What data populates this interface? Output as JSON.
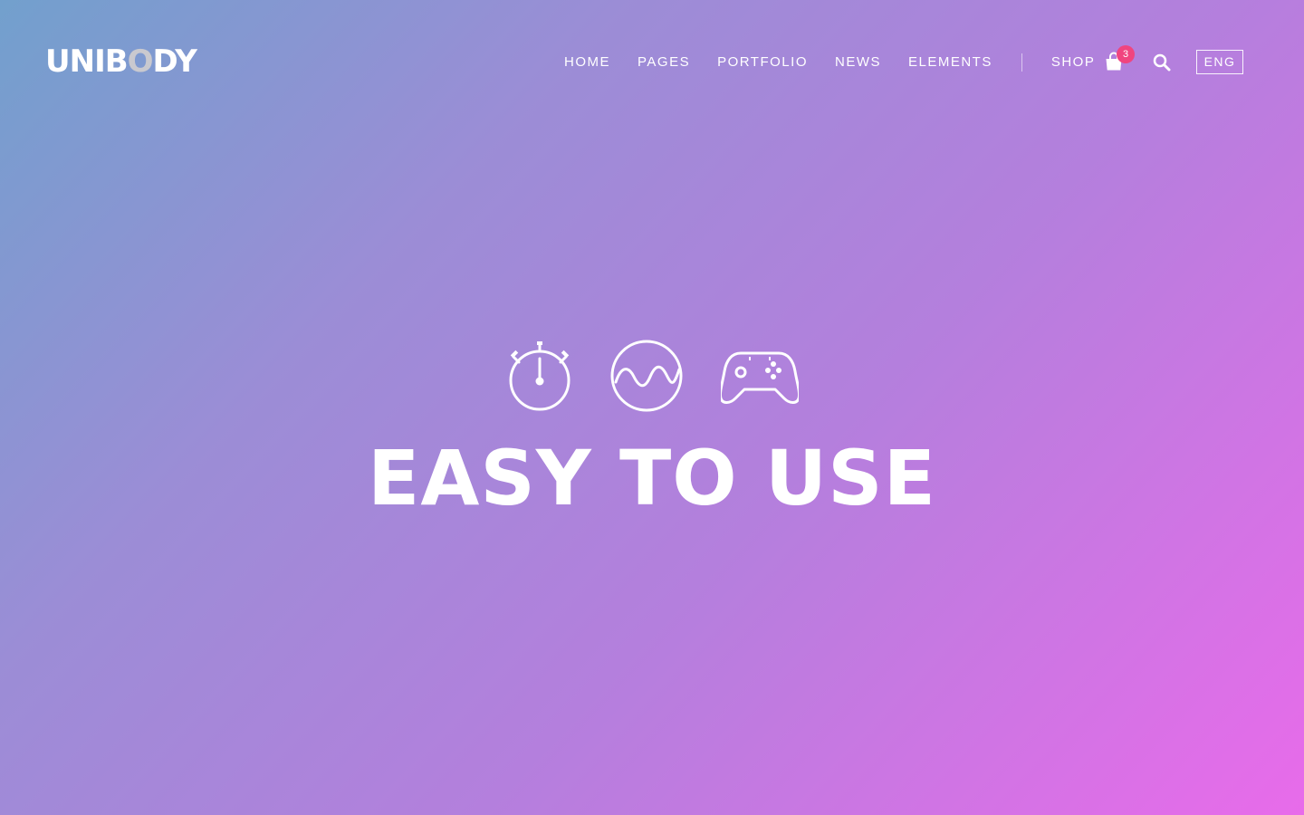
{
  "brand": {
    "logo_part1": "UNIB",
    "logo_accent": "O",
    "logo_part2": "DY"
  },
  "nav": {
    "items": [
      "HOME",
      "PAGES",
      "PORTFOLIO",
      "NEWS",
      "ELEMENTS"
    ],
    "shop_label": "SHOP"
  },
  "cart": {
    "icon": "shopping-bag-icon",
    "count": "3"
  },
  "search": {
    "icon": "search-icon"
  },
  "language": {
    "label": "ENG"
  },
  "hero": {
    "icons": [
      "stopwatch-icon",
      "wave-icon",
      "gamepad-icon"
    ],
    "headline": "EASY TO USE"
  },
  "colors": {
    "gradient_start": "#72a0cd",
    "gradient_end": "#e86bea",
    "badge": "#f0457f",
    "logo_accent": "#c9c9cf"
  }
}
